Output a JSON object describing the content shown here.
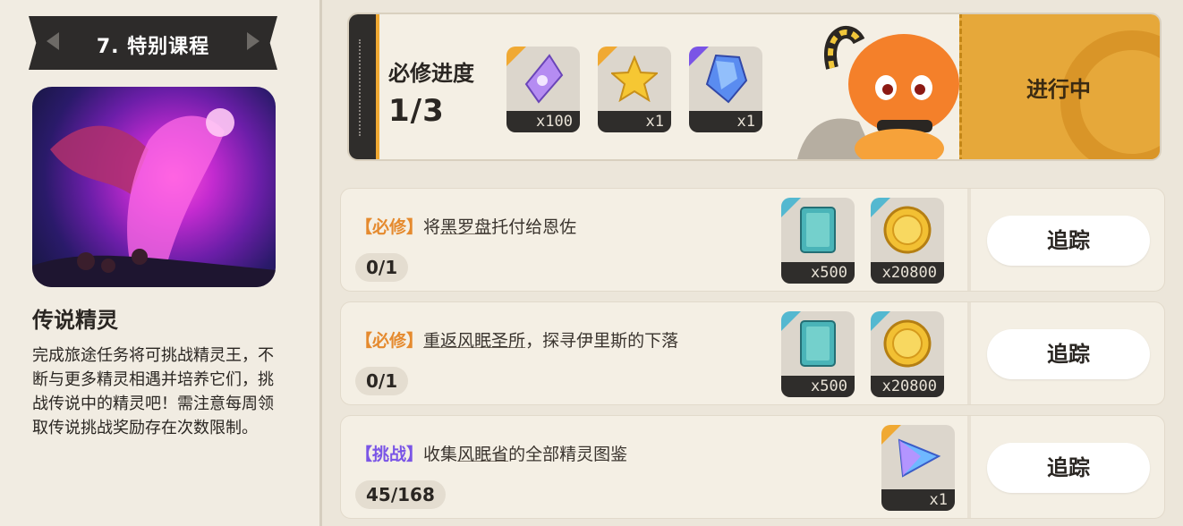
{
  "course": {
    "title": "7. 特别课程",
    "heading": "传说精灵",
    "description": "完成旅途任务将可挑战精灵王，不断与更多精灵相遇并培养它们，挑战传说中的精灵吧！需注意每周领取传说挑战奖励存在次数限制。"
  },
  "progress": {
    "label": "必修进度",
    "value": "1/3",
    "status": "进行中",
    "rewards": [
      {
        "icon": "purple-crystal-icon",
        "qty": "x100"
      },
      {
        "icon": "gold-star-icon",
        "qty": "x1"
      },
      {
        "icon": "blue-gem-icon",
        "qty": "x1"
      }
    ]
  },
  "tasks": [
    {
      "tag_open": "【",
      "tag": "必修",
      "tag_close": "】",
      "text_before": "将",
      "link": "黑罗盘",
      "text_after": "托付给恩佐",
      "count": "0/1",
      "button": "追踪",
      "rewards": [
        {
          "icon": "book-icon",
          "qty": "x500"
        },
        {
          "icon": "coin-icon",
          "qty": "x20800"
        }
      ]
    },
    {
      "tag_open": "【",
      "tag": "必修",
      "tag_close": "】",
      "text_before": "",
      "link": "重返风眠圣所",
      "text_after": "，探寻伊里斯的下落",
      "count": "0/1",
      "button": "追踪",
      "rewards": [
        {
          "icon": "book-icon",
          "qty": "x500"
        },
        {
          "icon": "coin-icon",
          "qty": "x20800"
        }
      ]
    },
    {
      "tag_open": "【",
      "tag": "挑战",
      "tag_close": "】",
      "text_before": "收集",
      "link": "风眠省",
      "text_after": "的全部精灵图鉴",
      "count": "45/168",
      "button": "追踪",
      "rewards": [
        {
          "icon": "prism-icon",
          "qty": "x1"
        }
      ]
    }
  ],
  "colors": {
    "accent_orange": "#f0a933",
    "status_gold": "#e6a83a",
    "challenge_purple": "#7a55e6",
    "dark": "#2f2d2b"
  }
}
